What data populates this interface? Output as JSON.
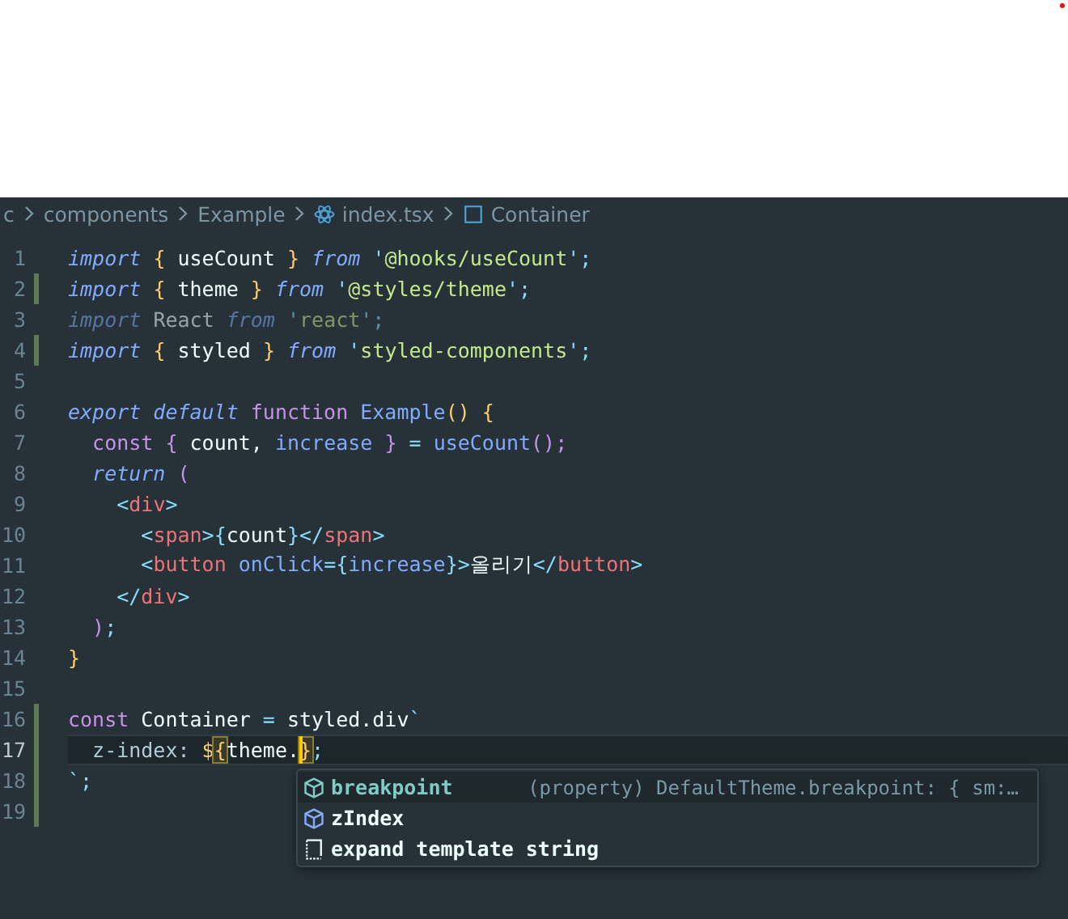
{
  "breadcrumb": [
    {
      "text": "c",
      "kind": "folder"
    },
    {
      "text": "components",
      "kind": "folder"
    },
    {
      "text": "Example",
      "kind": "folder"
    },
    {
      "text": "index.tsx",
      "kind": "file"
    },
    {
      "text": "Container",
      "kind": "symbol"
    }
  ],
  "lines": [
    {
      "number": "1",
      "changed": false,
      "faded": false,
      "current": false,
      "tokens": [
        {
          "text": "import ",
          "kind": "kw"
        },
        {
          "text": "{",
          "kind": "brace"
        },
        {
          "text": " useCount ",
          "kind": "ident"
        },
        {
          "text": "} ",
          "kind": "brace"
        },
        {
          "text": "from ",
          "kind": "kw"
        },
        {
          "text": "'",
          "kind": "punct"
        },
        {
          "text": "@hooks/useCount",
          "kind": "string"
        },
        {
          "text": "';",
          "kind": "punct"
        }
      ]
    },
    {
      "number": "2",
      "changed": true,
      "faded": false,
      "current": false,
      "tokens": [
        {
          "text": "import ",
          "kind": "kw"
        },
        {
          "text": "{",
          "kind": "brace"
        },
        {
          "text": " theme ",
          "kind": "ident"
        },
        {
          "text": "} ",
          "kind": "brace"
        },
        {
          "text": "from ",
          "kind": "kw"
        },
        {
          "text": "'",
          "kind": "punct"
        },
        {
          "text": "@styles/theme",
          "kind": "string"
        },
        {
          "text": "';",
          "kind": "punct"
        }
      ]
    },
    {
      "number": "3",
      "changed": false,
      "faded": true,
      "current": false,
      "tokens": [
        {
          "text": "import ",
          "kind": "kw"
        },
        {
          "text": "React ",
          "kind": "ident"
        },
        {
          "text": "from ",
          "kind": "kw"
        },
        {
          "text": "'",
          "kind": "punct"
        },
        {
          "text": "react",
          "kind": "string"
        },
        {
          "text": "';",
          "kind": "punct"
        }
      ]
    },
    {
      "number": "4",
      "changed": true,
      "faded": false,
      "current": false,
      "tokens": [
        {
          "text": "import ",
          "kind": "kw"
        },
        {
          "text": "{",
          "kind": "brace"
        },
        {
          "text": " styled ",
          "kind": "ident"
        },
        {
          "text": "} ",
          "kind": "brace"
        },
        {
          "text": "from ",
          "kind": "kw"
        },
        {
          "text": "'",
          "kind": "punct"
        },
        {
          "text": "styled-components",
          "kind": "string"
        },
        {
          "text": "';",
          "kind": "punct"
        }
      ]
    },
    {
      "number": "5",
      "changed": false,
      "current": false
    },
    {
      "number": "6",
      "changed": false,
      "faded": false,
      "current": false,
      "tokens": [
        {
          "text": "export default ",
          "kind": "kw"
        },
        {
          "text": "function ",
          "kind": "storage"
        },
        {
          "text": "Example",
          "kind": "fn"
        },
        {
          "text": "() ",
          "kind": "brace"
        },
        {
          "text": "{",
          "kind": "brace"
        }
      ]
    },
    {
      "number": "7",
      "changed": false,
      "faded": false,
      "current": false,
      "tokens": [
        {
          "text": "  const ",
          "kind": "storage"
        },
        {
          "text": "{",
          "kind": "brace2"
        },
        {
          "text": " count, ",
          "kind": "ident"
        },
        {
          "text": "increase ",
          "kind": "fn"
        },
        {
          "text": "}",
          "kind": "brace2"
        },
        {
          "text": " = ",
          "kind": "punct"
        },
        {
          "text": "useCount",
          "kind": "fn"
        },
        {
          "text": "();",
          "kind": "brace2"
        }
      ]
    },
    {
      "number": "8",
      "changed": false,
      "faded": false,
      "current": false,
      "tokens": [
        {
          "text": "  return ",
          "kind": "kw"
        },
        {
          "text": "(",
          "kind": "brace2"
        }
      ]
    },
    {
      "number": "9",
      "changed": false,
      "faded": false,
      "current": false,
      "tokens": [
        {
          "text": "    <",
          "kind": "punct"
        },
        {
          "text": "div",
          "kind": "tag"
        },
        {
          "text": ">",
          "kind": "punct"
        }
      ]
    },
    {
      "number": "10",
      "changed": false,
      "faded": false,
      "current": false,
      "tokens": [
        {
          "text": "      <",
          "kind": "punct"
        },
        {
          "text": "span",
          "kind": "tag"
        },
        {
          "text": ">{",
          "kind": "punct"
        },
        {
          "text": "count",
          "kind": "ident"
        },
        {
          "text": "}</",
          "kind": "punct"
        },
        {
          "text": "span",
          "kind": "tag"
        },
        {
          "text": ">",
          "kind": "punct"
        }
      ]
    },
    {
      "number": "11",
      "changed": false,
      "faded": false,
      "current": false,
      "tokens": [
        {
          "text": "      <",
          "kind": "punct"
        },
        {
          "text": "button ",
          "kind": "tag"
        },
        {
          "text": "onClick",
          "kind": "fn"
        },
        {
          "text": "={",
          "kind": "punct"
        },
        {
          "text": "increase",
          "kind": "fn"
        },
        {
          "text": "}>",
          "kind": "punct"
        },
        {
          "text": "올리기",
          "kind": "ident"
        },
        {
          "text": "</",
          "kind": "punct"
        },
        {
          "text": "button",
          "kind": "tag"
        },
        {
          "text": ">",
          "kind": "punct"
        }
      ]
    },
    {
      "number": "12",
      "changed": false,
      "faded": false,
      "current": false,
      "tokens": [
        {
          "text": "    </",
          "kind": "punct"
        },
        {
          "text": "div",
          "kind": "tag"
        },
        {
          "text": ">",
          "kind": "punct"
        }
      ]
    },
    {
      "number": "13",
      "changed": false,
      "faded": false,
      "current": false,
      "tokens": [
        {
          "text": "  )",
          "kind": "brace2"
        },
        {
          "text": ";",
          "kind": "punct"
        }
      ]
    },
    {
      "number": "14",
      "changed": false,
      "faded": false,
      "current": false,
      "tokens": [
        {
          "text": "}",
          "kind": "brace"
        }
      ]
    },
    {
      "number": "15",
      "changed": false,
      "current": false
    },
    {
      "number": "16",
      "changed": true,
      "faded": false,
      "current": false,
      "tokens": [
        {
          "text": "const ",
          "kind": "storage"
        },
        {
          "text": "Container ",
          "kind": "ident"
        },
        {
          "text": "=",
          "kind": "punct"
        },
        {
          "text": " styled.div",
          "kind": "ident"
        },
        {
          "text": "`",
          "kind": "punct"
        }
      ]
    },
    {
      "number": "17",
      "changed": true,
      "faded": false,
      "current": true,
      "tokens": [
        {
          "text": "  z-index: ",
          "kind": "css"
        },
        {
          "text": "$",
          "kind": "brace"
        },
        {
          "text": "{",
          "kind": "brace",
          "matched": true
        },
        {
          "text": "theme.",
          "kind": "ident"
        },
        {
          "text": "}",
          "kind": "brace",
          "matched": true,
          "caret": true
        },
        {
          "text": ";",
          "kind": "punct"
        }
      ]
    },
    {
      "number": "18",
      "changed": true,
      "faded": false,
      "current": false,
      "tokens": [
        {
          "text": "`",
          "kind": "punct"
        },
        {
          "text": ";",
          "kind": "punct"
        }
      ]
    },
    {
      "number": "19",
      "changed": true,
      "current": false
    }
  ],
  "suggestions": [
    {
      "label": "breakpoint",
      "kind": "property",
      "selected": true,
      "detail": "(property) DefaultTheme.breakpoint: { sm:…"
    },
    {
      "label": "zIndex",
      "kind": "property",
      "selected": false
    },
    {
      "label": "expand template string",
      "kind": "snippet",
      "selected": false
    }
  ]
}
